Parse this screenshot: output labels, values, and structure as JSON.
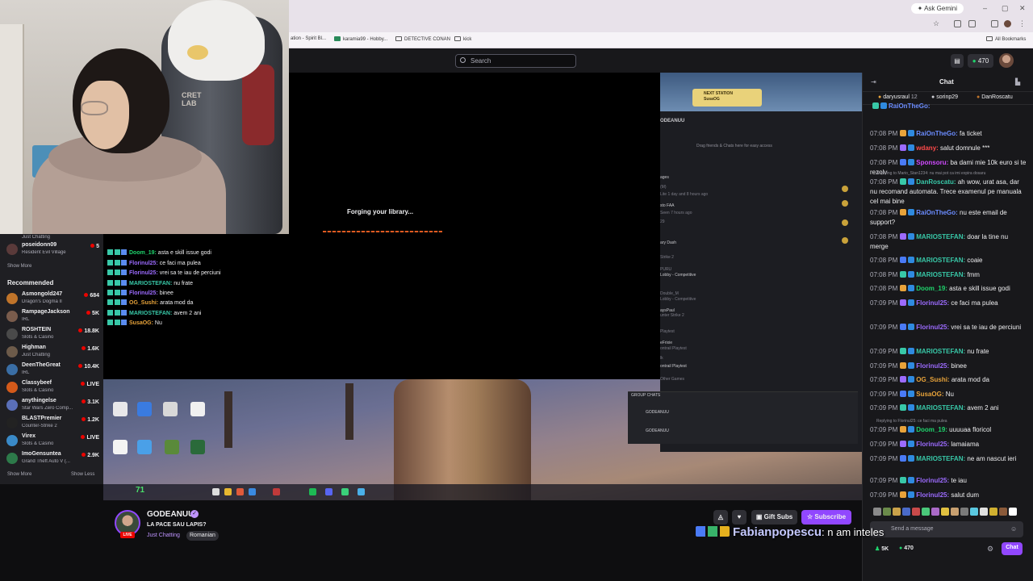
{
  "browser": {
    "ask_gemini": "Ask Gemini",
    "bookmarks": [
      {
        "label": "ation - Spirit Bl..."
      },
      {
        "label": "karamia99 - Hobby..."
      },
      {
        "label": "DETECTIVE CONAN"
      },
      {
        "label": "kick"
      }
    ],
    "all_bookmarks": "All Bookmarks"
  },
  "topnav": {
    "search_placeholder": "Search",
    "points": "470"
  },
  "sidebar": {
    "followed": [
      {
        "name": "Just Chatting",
        "game": "",
        "count": ""
      },
      {
        "name": "poseidonn09",
        "game": "Resident Evil Village",
        "count": "5"
      }
    ],
    "show_more_top": "Show More",
    "recommended_heading": "Recommended",
    "recommended": [
      {
        "name": "Asmongold247",
        "game": "Dragon's Dogma II",
        "count": "684",
        "color": "#c0742a"
      },
      {
        "name": "RampageJackson",
        "game": "IRL",
        "count": "5K",
        "color": "#7a5c4c"
      },
      {
        "name": "ROSHTEIN",
        "game": "Slots & Casino",
        "count": "18.8K",
        "color": "#4a4a4a"
      },
      {
        "name": "Highman",
        "game": "Just Chatting",
        "count": "1.6K",
        "color": "#6d5b4a"
      },
      {
        "name": "DeenTheGreat",
        "game": "IRL",
        "count": "10.4K",
        "color": "#3a6ea5"
      },
      {
        "name": "Classybeef",
        "game": "Slots & Casino",
        "count": "LIVE",
        "color": "#d45a1a"
      },
      {
        "name": "anythingelse",
        "game": "Star Wars Zero Comp...",
        "count": "3.1K",
        "color": "#5a6fb8"
      },
      {
        "name": "BLASTPremier",
        "game": "Counter-Strike 2",
        "count": "1.2K",
        "color": "#222"
      },
      {
        "name": "Virex",
        "game": "Slots & Casino",
        "count": "LIVE",
        "color": "#3a8ac8"
      },
      {
        "name": "ImoGensuntea",
        "game": "Grand Theft Auto V (...",
        "count": "2.9K",
        "color": "#2d7a4a"
      }
    ],
    "show_more": "Show More",
    "show_less": "Show Less"
  },
  "webcam": {
    "chair_brand": "CRET\nLAB"
  },
  "player": {
    "loading_text": "Forging your library...",
    "overlay_chat": [
      {
        "user": "",
        "text": ""
      },
      {
        "user": "Doom_19:",
        "text": "asta e skill issue godi",
        "color": "#1fd36c"
      },
      {
        "user": "Florinul25:",
        "text": "ce faci ma pulea",
        "color": "#9c6bff"
      },
      {
        "user": "Florinul25:",
        "text": "vrei sa te iau de perciuni",
        "color": "#9c6bff"
      },
      {
        "user": "MARIOSTEFAN:",
        "text": "nu frate",
        "color": "#38c8a8"
      },
      {
        "user": "Florinul25:",
        "text": "binee",
        "color": "#9c6bff"
      },
      {
        "user": "OG_Sushi:",
        "text": "arata mod da",
        "color": "#e8a33a"
      },
      {
        "user": "MARIOSTEFAN:",
        "text": "avem 2 ani",
        "color": "#38c8a8"
      },
      {
        "user": "SusaOG:",
        "text": "Nu",
        "color": "#e8a33a"
      }
    ],
    "station": "NEXT STATION\nSusaOG",
    "app_title": "ODEANUU",
    "app_hint": "Drag friends & Chats here for easy access",
    "app_items": [
      "ages",
      "(M)",
      "Lite 1 day and 8 hours ago",
      "sto FAA",
      "Seen 7 hours ago",
      "29",
      "ary Dash",
      "Strike 2",
      "PURU",
      "Lobby - Competitive",
      "Double_M",
      "Lobby - Competitive",
      "aysPaul",
      "unter Strike 2",
      "Playtest",
      "eFrixie",
      "ontrail Playtest",
      "lk",
      "ontrail Playtest",
      "Other Games"
    ],
    "group_chats": "GROUP CHATS",
    "group_items": [
      "GODEANUU",
      "GODEANUU"
    ],
    "desktop_icons": [
      "Gemtoo.co...",
      "Darry's Mod",
      "image",
      "Mortal Shel -...",
      "Get!-trmp",
      "Ca...ral",
      "Epixel",
      "Sam-ram Your Friends"
    ],
    "hud_value": "71"
  },
  "stream": {
    "channel": "GODEANUU",
    "title": "LA PACE SAU LAPIS?",
    "category": "Just Chatting",
    "tag": "Romanian",
    "live": "LIVE",
    "gift_subs": "Gift Subs",
    "subscribe": "Subscribe"
  },
  "overlay_message": {
    "user": "Fabianpopescu",
    "text": ": n am inteles"
  },
  "chat": {
    "title": "Chat",
    "gifters": [
      {
        "name": "daryusraul",
        "count": "12"
      },
      {
        "name": "sorinp29",
        "count": ""
      },
      {
        "name": "DanRoscatu",
        "count": ""
      }
    ],
    "messages": [
      {
        "time": "",
        "user": "RaiOnTheGo:",
        "text": "",
        "color": "#6b8cff",
        "reply": ""
      },
      {
        "time": "07:08 PM",
        "user": "RaiOnTheGo:",
        "text": "fa ticket",
        "color": "#6b8cff",
        "reply": ""
      },
      {
        "time": "07:08 PM",
        "user": "wdany:",
        "text": "salut domnule ***",
        "color": "#ff4a4a",
        "reply": ""
      },
      {
        "time": "07:08 PM",
        "user": "Sponsoru:",
        "text": "ba dami mie 10k euro si te rezolv",
        "color": "#d04aff",
        "reply": ""
      },
      {
        "time": "07:08 PM",
        "user": "DanRoscatu:",
        "text": "ah wow, urat asa, dar nu recomand automata. Trece examenul pe manuala cel mai bine",
        "color": "#38c8a8",
        "reply": "Replying to Mario_Stan1234: nu mai pot ca imi expira dosaru"
      },
      {
        "time": "07:08 PM",
        "user": "RaiOnTheGo:",
        "text": "nu este email de support?",
        "color": "#6b8cff",
        "reply": ""
      },
      {
        "time": "07:08 PM",
        "user": "MARIOSTEFAN:",
        "text": "doar la tine nu merge",
        "color": "#38c8a8",
        "reply": ""
      },
      {
        "time": "07:08 PM",
        "user": "MARIOSTEFAN:",
        "text": "coaie",
        "color": "#38c8a8",
        "reply": ""
      },
      {
        "time": "07:08 PM",
        "user": "MARIOSTEFAN:",
        "text": "fmm",
        "color": "#38c8a8",
        "reply": ""
      },
      {
        "time": "07:08 PM",
        "user": "Doom_19:",
        "text": "asta e skill issue godi",
        "color": "#1fd36c",
        "reply": ""
      },
      {
        "time": "07:09 PM",
        "user": "Florinul25:",
        "text": "ce faci ma pulea",
        "color": "#9c6bff",
        "reply": ""
      },
      {
        "time": "07:09 PM",
        "user": "Florinul25:",
        "text": "vrei sa te iau de perciuni",
        "color": "#9c6bff",
        "reply": ""
      },
      {
        "time": "07:09 PM",
        "user": "MARIOSTEFAN:",
        "text": "nu frate",
        "color": "#38c8a8",
        "reply": ""
      },
      {
        "time": "07:09 PM",
        "user": "Florinul25:",
        "text": "binee",
        "color": "#9c6bff",
        "reply": ""
      },
      {
        "time": "07:09 PM",
        "user": "OG_Sushi:",
        "text": "arata mod da",
        "color": "#e8a33a",
        "reply": ""
      },
      {
        "time": "07:09 PM",
        "user": "SusaOG:",
        "text": "Nu",
        "color": "#e8a33a",
        "reply": ""
      },
      {
        "time": "07:09 PM",
        "user": "MARIOSTEFAN:",
        "text": "avem 2 ani",
        "color": "#38c8a8",
        "reply": ""
      },
      {
        "time": "07:09 PM",
        "user": "Doom_19:",
        "text": "uuuuaa floricol",
        "color": "#1fd36c",
        "reply": "Replying to Florinul25: ce faci ma pulea"
      },
      {
        "time": "07:09 PM",
        "user": "Florinul25:",
        "text": "lamaiama",
        "color": "#9c6bff",
        "reply": ""
      },
      {
        "time": "07:09 PM",
        "user": "MARIOSTEFAN:",
        "text": "ne am nascut ieri",
        "color": "#38c8a8",
        "reply": ""
      },
      {
        "time": "07:09 PM",
        "user": "Florinul25:",
        "text": "te iau",
        "color": "#9c6bff",
        "reply": ""
      },
      {
        "time": "07:09 PM",
        "user": "Florinul25:",
        "text": "salut dum",
        "color": "#9c6bff",
        "reply": ""
      }
    ],
    "input_placeholder": "Send a message",
    "viewers": "5K",
    "points": "470",
    "chat_button": "Chat"
  }
}
